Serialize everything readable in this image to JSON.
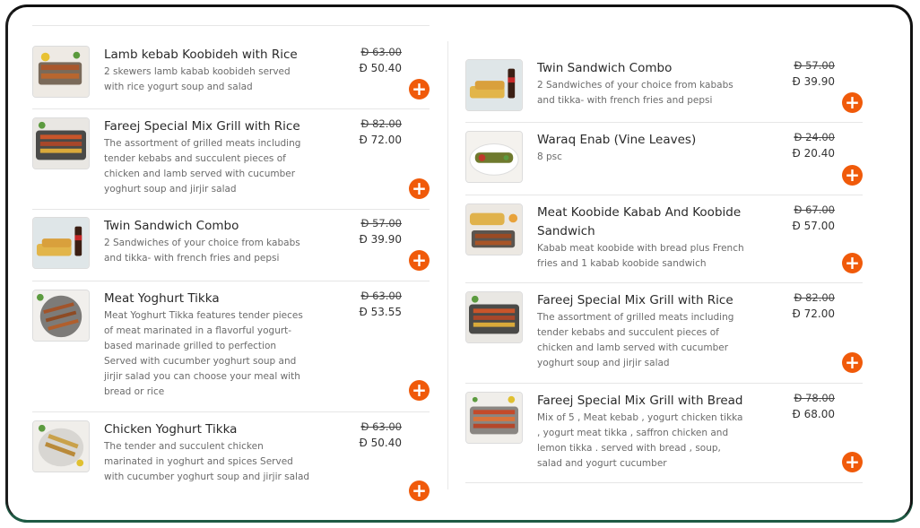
{
  "currency_symbol": "Ð",
  "colors": {
    "accent": "#f05a0a",
    "frame_bottom": "#1f5a44"
  },
  "left_column": [
    {
      "name": "Lamb kebab Koobideh with Rice",
      "description": "2 skewers lamb kabab koobideh served with rice yogurt soup and salad",
      "old_price": "Ð 63.00",
      "price": "Ð 50.40",
      "icon": "add-icon"
    },
    {
      "name": "Fareej Special Mix Grill with Rice",
      "description": "The assortment of grilled meats including tender kebabs and succulent pieces of chicken and lamb served with cucumber yoghurt soup and jirjir salad",
      "old_price": "Ð 82.00",
      "price": "Ð 72.00",
      "icon": "add-icon"
    },
    {
      "name": "Twin Sandwich Combo",
      "description": "2 Sandwiches of your choice from kababs and tikka- with french fries and pepsi",
      "old_price": "Ð 57.00",
      "price": "Ð 39.90",
      "icon": "add-icon"
    },
    {
      "name": "Meat Yoghurt Tikka",
      "description": "Meat Yoghurt Tikka features tender pieces of meat marinated in a flavorful yogurt-based marinade grilled to perfection Served with cucumber yoghurt soup and jirjir salad you can choose your meal with bread or rice",
      "old_price": "Ð 63.00",
      "price": "Ð 53.55",
      "icon": "add-icon"
    },
    {
      "name": "Chicken Yoghurt Tikka",
      "description": "The tender and succulent chicken marinated in yoghurt and spices Served with cucumber yoghurt soup and jirjir salad",
      "old_price": "Ð 63.00",
      "price": "Ð 50.40",
      "icon": "add-icon"
    }
  ],
  "right_column": [
    {
      "name": "Twin Sandwich Combo",
      "description": "2 Sandwiches of your choice from kababs and tikka- with french fries and pepsi",
      "old_price": "Ð 57.00",
      "price": "Ð 39.90",
      "icon": "add-icon"
    },
    {
      "name": "Waraq Enab (Vine Leaves)",
      "description": "8 psc",
      "old_price": "Ð 24.00",
      "price": "Ð 20.40",
      "icon": "add-icon"
    },
    {
      "name": "Meat Koobide Kabab And Koobide Sandwich",
      "description": "Kabab meat koobide with bread plus French fries and 1 kabab koobide sandwich",
      "old_price": "Ð 67.00",
      "price": "Ð 57.00",
      "icon": "add-icon"
    },
    {
      "name": "Fareej Special Mix Grill with Rice",
      "description": "The assortment of grilled meats including tender kebabs and succulent pieces of chicken and lamb served with cucumber yoghurt soup and jirjir salad",
      "old_price": "Ð 82.00",
      "price": "Ð 72.00",
      "icon": "add-icon"
    },
    {
      "name": "Fareej Special Mix Grill with Bread",
      "description": "Mix of 5 , Meat kebab , yogurt chicken tikka , yogurt meat tikka , saffron chicken and lemon tikka . served with bread , soup, salad and yogurt cucumber",
      "old_price": "Ð 78.00",
      "price": "Ð 68.00",
      "icon": "add-icon"
    }
  ]
}
